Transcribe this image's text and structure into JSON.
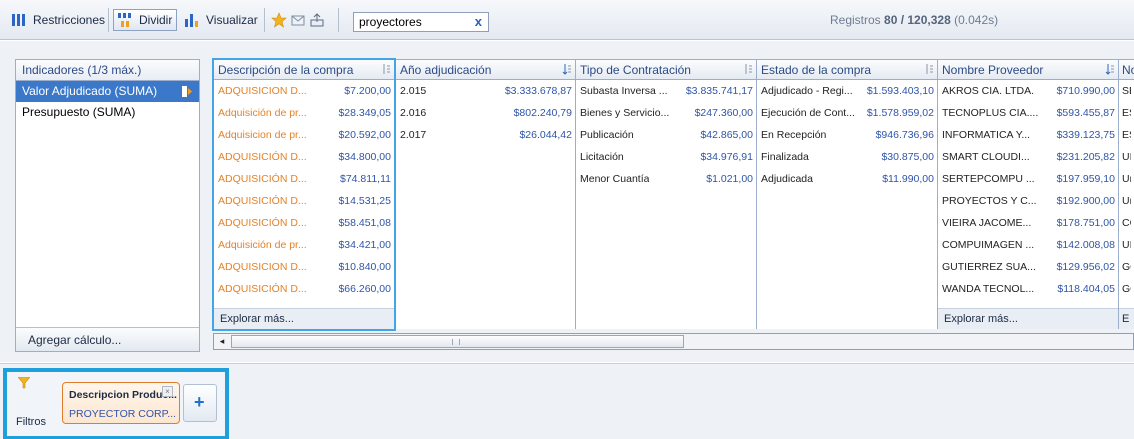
{
  "toolbar": {
    "restricciones_label": "Restricciones",
    "dividir_label": "Dividir",
    "visualizar_label": "Visualizar",
    "search_value": "proyectores",
    "search_clear": "x",
    "registros_prefix": "Registros",
    "registros_count": "80 / 120,328",
    "registros_time": "(0.042s)"
  },
  "indicators": {
    "header": "Indicadores (1/3 máx.)",
    "items": [
      {
        "label": "Valor Adjudicado (SUMA)",
        "selected": true
      },
      {
        "label": "Presupuesto (SUMA)",
        "selected": false
      }
    ],
    "footer": "Agregar cálculo..."
  },
  "columns": [
    {
      "header": "Descripción de la compra",
      "rows": [
        {
          "label": "ADQUISICION D...",
          "value": "$7.200,00"
        },
        {
          "label": "Adquisición de pr...",
          "value": "$28.349,05"
        },
        {
          "label": "Adquisicion de pr...",
          "value": "$20.592,00"
        },
        {
          "label": "ADQUISICIÓN D...",
          "value": "$34.800,00"
        },
        {
          "label": "ADQUISICIÓN D...",
          "value": "$74.811,11"
        },
        {
          "label": "ADQUISICIÓN D...",
          "value": "$14.531,25"
        },
        {
          "label": "ADQUISICIÓN D...",
          "value": "$58.451,08"
        },
        {
          "label": "Adquisición de pr...",
          "value": "$34.421,00"
        },
        {
          "label": "ADQUISICION D...",
          "value": "$10.840,00"
        },
        {
          "label": "ADQUISICIÓN D...",
          "value": "$66.260,00"
        }
      ],
      "explore": "Explorar más..."
    },
    {
      "header": "Año adjudicación",
      "rows": [
        {
          "label": "2.015",
          "value": "$3.333.678,87"
        },
        {
          "label": "2.016",
          "value": "$802.240,79"
        },
        {
          "label": "2.017",
          "value": "$26.044,42"
        }
      ]
    },
    {
      "header": "Tipo de Contratación",
      "rows": [
        {
          "label": "Subasta Inversa ...",
          "value": "$3.835.741,17"
        },
        {
          "label": "Bienes y Servicio...",
          "value": "$247.360,00"
        },
        {
          "label": "Publicación",
          "value": "$42.865,00"
        },
        {
          "label": "Licitación",
          "value": "$34.976,91"
        },
        {
          "label": "Menor Cuantía",
          "value": "$1.021,00"
        }
      ]
    },
    {
      "header": "Estado de la compra",
      "rows": [
        {
          "label": "Adjudicado - Regi...",
          "value": "$1.593.403,10"
        },
        {
          "label": "Ejecución de Cont...",
          "value": "$1.578.959,02"
        },
        {
          "label": "En Recepción",
          "value": "$946.736,96"
        },
        {
          "label": "Finalizada",
          "value": "$30.875,00"
        },
        {
          "label": "Adjudicada",
          "value": "$11.990,00"
        }
      ]
    },
    {
      "header": "Nombre Proveedor",
      "rows": [
        {
          "label": "AKROS CIA. LTDA.",
          "value": "$710.990,00"
        },
        {
          "label": "TECNOPLUS CIA....",
          "value": "$593.455,87"
        },
        {
          "label": "INFORMATICA Y...",
          "value": "$339.123,75"
        },
        {
          "label": "SMART CLOUDI...",
          "value": "$231.205,82"
        },
        {
          "label": "SERTEPCOMPU ...",
          "value": "$197.959,10"
        },
        {
          "label": "PROYECTOS Y C...",
          "value": "$192.900,00"
        },
        {
          "label": "VIEIRA JACOME...",
          "value": "$178.751,00"
        },
        {
          "label": "COMPUIMAGEN ...",
          "value": "$142.008,08"
        },
        {
          "label": "GUTIERREZ SUA...",
          "value": "$129.956,02"
        },
        {
          "label": "WANDA TECNOL...",
          "value": "$118.404,05"
        }
      ],
      "explore": "Explorar más..."
    },
    {
      "header": "No",
      "rows": [
        {
          "label": "SE"
        },
        {
          "label": "ES"
        },
        {
          "label": "ES"
        },
        {
          "label": "UI"
        },
        {
          "label": "Ur"
        },
        {
          "label": "Ur"
        },
        {
          "label": "CC"
        },
        {
          "label": "UI"
        },
        {
          "label": "GC"
        },
        {
          "label": "GC"
        }
      ],
      "explore": "E"
    }
  ],
  "scrollbar": {
    "left_arrow": "◂",
    "grip": "III"
  },
  "filters": {
    "label": "Filtros",
    "chip_title": "Descripcion Produc...",
    "chip_value": "PROYECTOR CORP...",
    "chip_close": "×",
    "add": "+"
  },
  "colors": {
    "accent": "#1ea0dc",
    "selection": "#3b78c9",
    "value_blue": "#2f55a8",
    "orange": "#e48227"
  }
}
